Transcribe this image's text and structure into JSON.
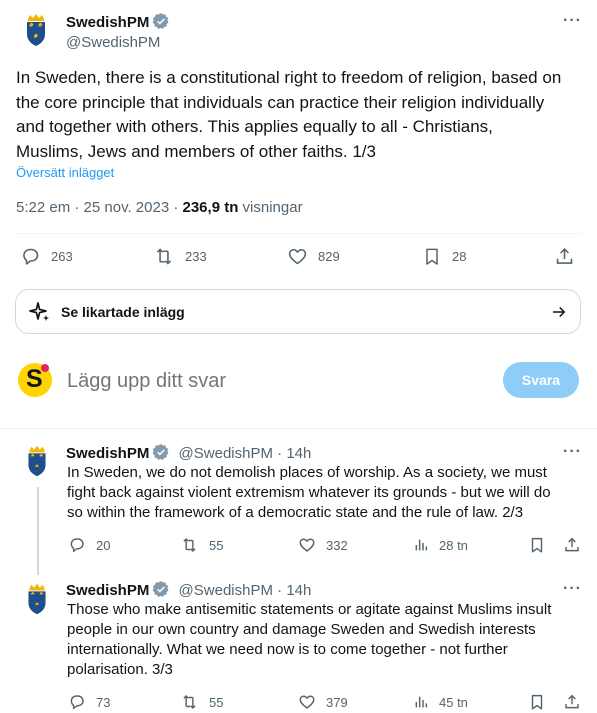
{
  "main_tweet": {
    "name": "SwedishPM",
    "handle": "@SwedishPM",
    "text_lines": [
      "In Sweden, there is a constitutional right to freedom of religion, based on",
      "the core principle that individuals can practice their religion individually",
      "and together with others. This applies equally to all - Christians,",
      "Muslims, Jews and members of other faiths. 1/3"
    ],
    "translate_label": "Översätt inlägget",
    "time": "5:22 em · 25 nov. 2023 · ",
    "views_count": "236,9 tn",
    "views_label": " visningar",
    "stats": {
      "replies": "263",
      "reposts": "233",
      "likes": "829",
      "bookmarks": "28"
    }
  },
  "similar_posts": {
    "label": "Se likartade inlägg"
  },
  "compose": {
    "placeholder": "Lägg upp ditt svar",
    "reply_button": "Svara"
  },
  "replies": [
    {
      "name": "SwedishPM",
      "handle": "@SwedishPM",
      "time": "14h",
      "text_lines": [
        "In Sweden, we do not demolish places of worship. As a society, we must",
        "fight back against violent extremism whatever its grounds - but we will do",
        "so within the framework of a democratic state and the rule of law. 2/3"
      ],
      "stats": {
        "replies": "20",
        "reposts": "55",
        "likes": "332",
        "views": "28 tn"
      }
    },
    {
      "name": "SwedishPM",
      "handle": "@SwedishPM",
      "time": "14h",
      "text_lines": [
        "Those who make antisemitic statements or agitate against Muslims insult",
        "people in our own country and damage Sweden and Swedish interests",
        "internationally. What we need now is to come together - not further",
        "polarisation. 3/3"
      ],
      "stats": {
        "replies": "73",
        "reposts": "55",
        "likes": "379",
        "views": "45 tn"
      }
    }
  ],
  "colors": {
    "accent": "#1d9bf0",
    "verified": "#829aab",
    "muted": "#536471",
    "reply_button_disabled": "#8ecdf8",
    "compose_avatar": "#ffd400"
  },
  "icons": [
    "swedish-coat-of-arms-icon",
    "verified-badge-icon",
    "more-icon",
    "reply-icon",
    "repost-icon",
    "like-icon",
    "bookmark-icon",
    "share-icon",
    "sparkle-icon",
    "arrow-right-icon",
    "views-icon"
  ]
}
